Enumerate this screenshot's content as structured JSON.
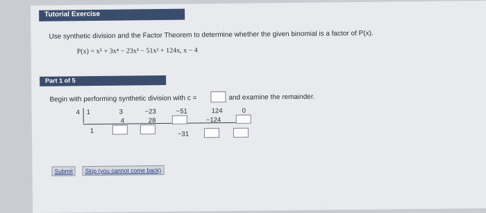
{
  "header": {
    "title": "Tutorial Exercise"
  },
  "instructions": "Use synthetic division and the Factor Theorem to determine whether the given binomial is a factor of P(x).",
  "polynomial": "P(x) = x⁵ + 3x⁴ − 23x³ − 51x² + 124x,  x − 4",
  "part": {
    "label": "Part 1 of 5",
    "prompt_before": "Begin with performing synthetic division with c =",
    "prompt_after": "and examine the remainder."
  },
  "division": {
    "divisor": "4",
    "coefficients": [
      "1",
      "3",
      "−23",
      "−51",
      "124",
      "0"
    ],
    "middle_row": [
      "4",
      "28",
      "",
      "−124",
      ""
    ],
    "bottom_row": [
      "1",
      "",
      "",
      "−31",
      "",
      ""
    ]
  },
  "buttons": {
    "submit": "Submit",
    "skip": "Skip (you cannot come back)"
  }
}
